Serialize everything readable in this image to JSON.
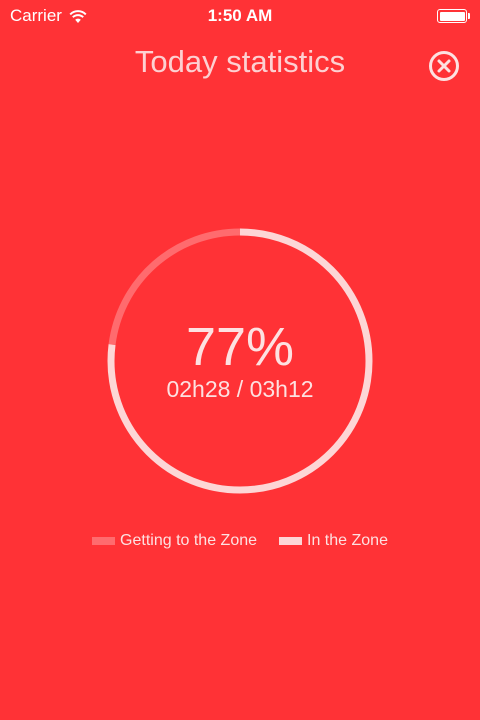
{
  "status_bar": {
    "carrier": "Carrier",
    "time": "1:50 AM",
    "battery_level": 1.0
  },
  "header": {
    "title": "Today statistics",
    "close_icon": "close-circle-icon"
  },
  "stats": {
    "percent_label": "77%",
    "percent_value": 77,
    "duration_label": "02h28 / 03h12"
  },
  "legend": {
    "items": [
      {
        "label": "Getting to the Zone",
        "color": "#ff6b6e"
      },
      {
        "label": "In the Zone",
        "color": "#fdd6d6"
      }
    ]
  },
  "colors": {
    "background": "#ff3236",
    "ring_in_zone": "#fdd6d6",
    "ring_getting": "#ff6b6e",
    "text": "#fde1e1"
  }
}
